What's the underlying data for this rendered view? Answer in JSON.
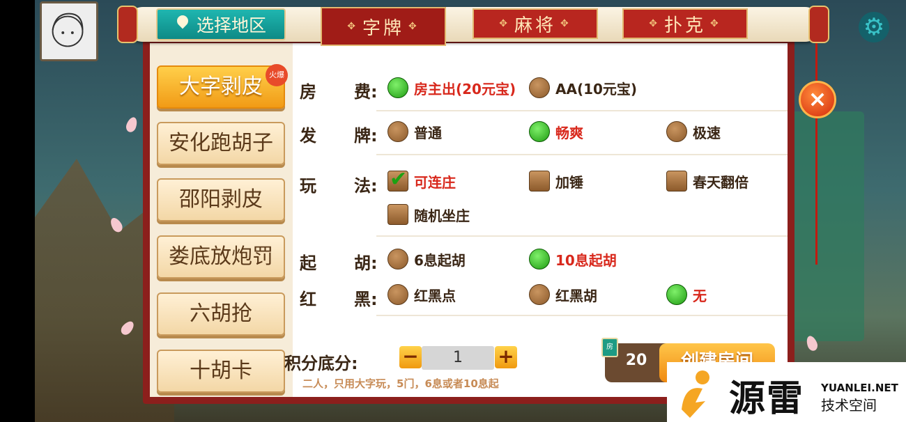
{
  "region_tab": {
    "label": "选择地区"
  },
  "tabs": [
    {
      "label": "字牌",
      "active": true
    },
    {
      "label": "麻将",
      "active": false
    },
    {
      "label": "扑克",
      "active": false
    }
  ],
  "games": [
    {
      "label": "大字剥皮",
      "badge": "火爆",
      "active": true
    },
    {
      "label": "安化跑胡子"
    },
    {
      "label": "邵阳剥皮"
    },
    {
      "label": "娄底放炮罚"
    },
    {
      "label": "六胡抢"
    },
    {
      "label": "十胡卡"
    }
  ],
  "options": {
    "fee": {
      "label_a": "房",
      "label_b": "费:",
      "choices": [
        "房主出(20元宝)",
        "AA(10元宝)"
      ],
      "selected": 0
    },
    "deal": {
      "label_a": "发",
      "label_b": "牌:",
      "choices": [
        "普通",
        "畅爽",
        "极速"
      ],
      "selected": 1
    },
    "play": {
      "label_a": "玩",
      "label_b": "法:",
      "choices": [
        "可连庄",
        "加锤",
        "春天翻倍",
        "随机坐庄"
      ],
      "checked": [
        0
      ]
    },
    "hu": {
      "label_a": "起",
      "label_b": "胡:",
      "choices": [
        "6息起胡",
        "10息起胡"
      ],
      "selected": 1
    },
    "redblack": {
      "label_a": "红",
      "label_b": "黑:",
      "choices": [
        "红黑点",
        "红黑胡",
        "无"
      ],
      "selected": 2
    }
  },
  "score": {
    "label": "积分底分:",
    "value": "1",
    "minus": "−",
    "plus": "+"
  },
  "description": "二人，只用大字玩，5门，6息或者10息起",
  "cost": {
    "value": "20",
    "icon": "房"
  },
  "create_button": "创建房间",
  "close_icon": "×",
  "watermark": {
    "brand": "源雷",
    "en": "YUANLEI.NET",
    "cn": "技术空间"
  }
}
